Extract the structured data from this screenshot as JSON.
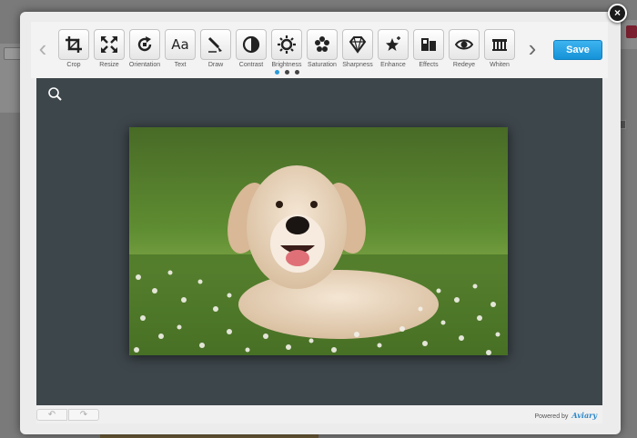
{
  "modal": {
    "close_label": "×"
  },
  "toolbar": {
    "prev_label": "‹",
    "next_label": "›",
    "save_label": "Save",
    "tools": [
      {
        "label": "Crop",
        "icon": "crop-icon"
      },
      {
        "label": "Resize",
        "icon": "resize-icon"
      },
      {
        "label": "Orientation",
        "icon": "orientation-icon"
      },
      {
        "label": "Text",
        "icon": "text-icon",
        "glyph": "Aa"
      },
      {
        "label": "Draw",
        "icon": "draw-icon"
      },
      {
        "label": "Contrast",
        "icon": "contrast-icon"
      },
      {
        "label": "Brightness",
        "icon": "brightness-icon"
      },
      {
        "label": "Saturation",
        "icon": "saturation-icon"
      },
      {
        "label": "Sharpness",
        "icon": "sharpness-icon"
      },
      {
        "label": "Enhance",
        "icon": "enhance-icon"
      },
      {
        "label": "Effects",
        "icon": "effects-icon"
      },
      {
        "label": "Redeye",
        "icon": "redeye-icon"
      },
      {
        "label": "Whiten",
        "icon": "whiten-icon"
      }
    ],
    "page_dots": {
      "count": 3,
      "active": 0,
      "active_color": "#2a9ad8"
    }
  },
  "editor": {
    "zoom_icon": "zoom-icon",
    "image_subject": "golden retriever lying in a field of white flowers"
  },
  "footer": {
    "undo_label": "↶",
    "redo_label": "↷",
    "powered_by": "Powered by",
    "brand": "Aviary"
  },
  "colors": {
    "accent": "#1f9de0",
    "canvas": "#3d464b"
  }
}
